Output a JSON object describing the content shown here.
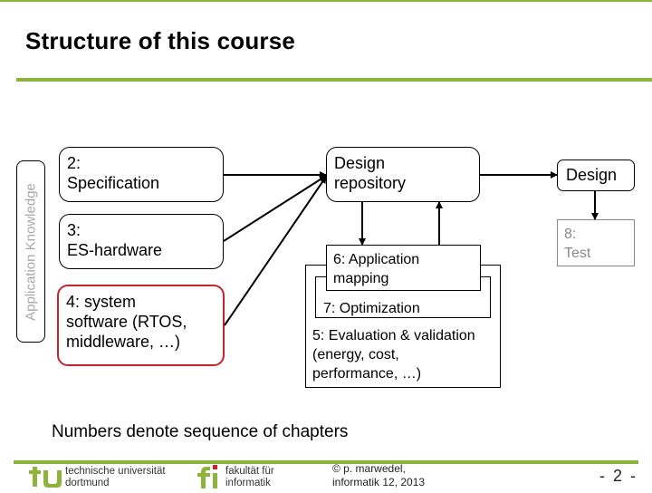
{
  "slide": {
    "title": "Structure of this course",
    "side_label": "Application Knowledge",
    "boxes": {
      "spec": "2:\nSpecification",
      "spec_num": "2:",
      "spec_name": "Specification",
      "hw_num": "3:",
      "hw_name": "ES-hardware",
      "sw_line1": "4: system",
      "sw_line2": "software (RTOS,",
      "sw_line3": "middleware, …)",
      "repo_line1": "Design",
      "repo_line2": "repository",
      "mapping_line1": "6: Application",
      "mapping_line2": "mapping",
      "optimization": "7: Optimization",
      "eval_line1": "5: Evaluation & validation",
      "eval_line2": "(energy, cost,",
      "eval_line3": "performance, …)",
      "design": "Design",
      "test_num": "8:",
      "test_name": "Test"
    },
    "note": "Numbers denote sequence of chapters",
    "colors": {
      "accent": "#8cb43c",
      "highlight": "#c0262c",
      "muted": "#888888"
    }
  },
  "footer": {
    "tu_logo": "tu",
    "university_line1": "technische universität",
    "university_line2": "dortmund",
    "fi_logo": "fi",
    "faculty_line1": "fakultät für",
    "faculty_line2": "informatik",
    "copyright_line1": "© p. marwedel,",
    "copyright_line2": "informatik 12,  2013",
    "page_number": "- 2 -"
  }
}
